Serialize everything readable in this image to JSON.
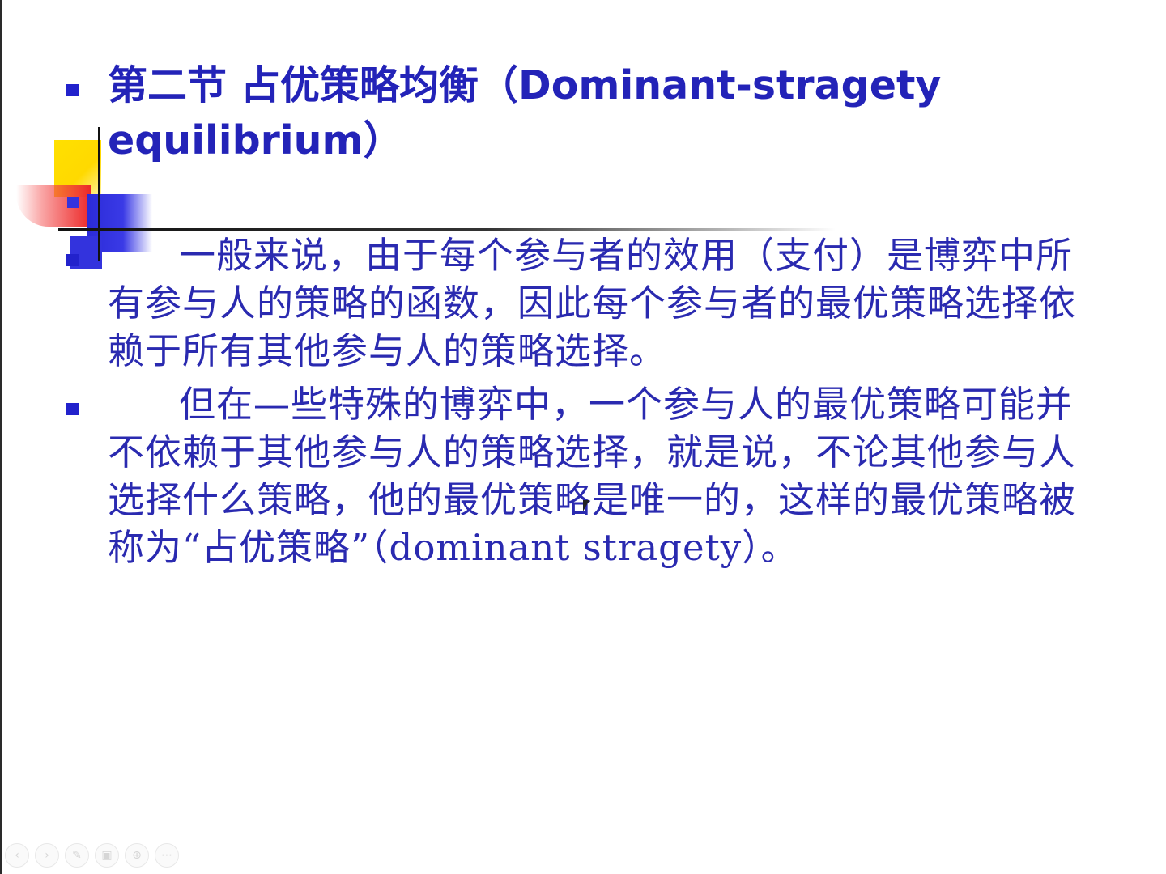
{
  "slide": {
    "title": "第二节 占优策略均衡（Dominant-stragety equilibrium）",
    "paragraphs": [
      "一般来说，由于每个参与者的效用（支付）是博弈中所有参与人的策略的函数，因此每个参与者的最优策略选择依赖于所有其他参与人的策略选择。",
      "但在—些特殊的博弈中，一个参与人的最优策略可能并不依赖于其他参与人的策略选择，就是说，不论其他参与人选择什么策略，他的最优策略是唯一的，这样的最优策略被称为“占优策略”（dominant stragety）。"
    ]
  },
  "toolbar": {
    "buttons": [
      {
        "icon": "previous-icon",
        "glyph": "‹"
      },
      {
        "icon": "next-icon",
        "glyph": "›"
      },
      {
        "icon": "pen-icon",
        "glyph": "✎"
      },
      {
        "icon": "slides-icon",
        "glyph": "▣"
      },
      {
        "icon": "zoom-icon",
        "glyph": "⊕"
      },
      {
        "icon": "more-icon",
        "glyph": "⋯"
      }
    ]
  },
  "colors": {
    "text": "#2a2ab0",
    "bullet": "#2222cc",
    "accent_yellow": "#ffd900",
    "accent_red": "#ec2828"
  }
}
